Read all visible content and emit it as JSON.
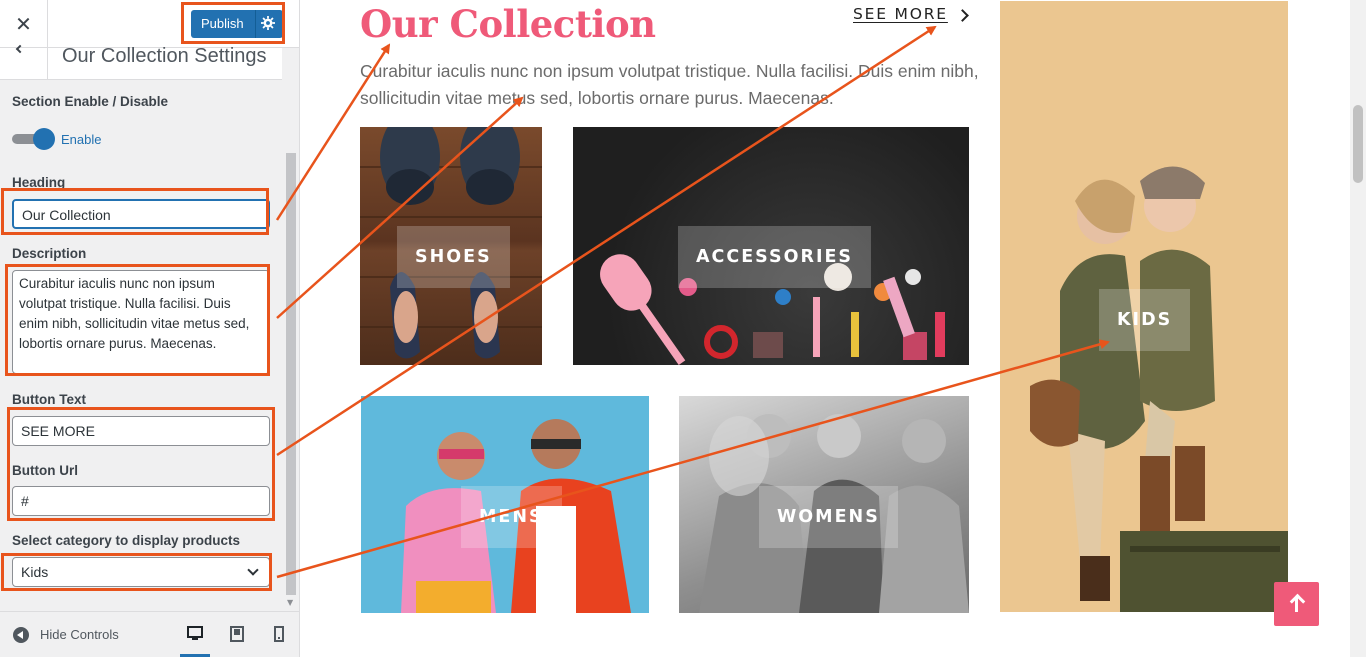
{
  "customizer": {
    "close_glyph": "✕",
    "publish_label": "Publish",
    "section_title": "Our Collection Settings",
    "enable_section_label": "Section Enable / Disable",
    "toggle_state": "on",
    "toggle_label": "Enable",
    "heading_label": "Heading",
    "heading_value": "Our Collection",
    "description_label": "Description",
    "description_value": "Curabitur iaculis nunc non ipsum volutpat tristique. Nulla facilisi. Duis enim nibh, sollicitudin vitae metus sed, lobortis ornare purus. Maecenas.",
    "button_text_label": "Button Text",
    "button_text_value": "SEE MORE",
    "button_url_label": "Button Url",
    "button_url_value": "#",
    "category_label": "Select category to display products",
    "category_value": "Kids",
    "hide_controls_label": "Hide Controls",
    "devices": [
      "desktop",
      "tablet",
      "mobile"
    ],
    "active_device": "desktop",
    "accent_color": "#2271b1"
  },
  "preview": {
    "title": "Our Collection",
    "see_more": "SEE MORE",
    "description": "Curabitur iaculis nunc non ipsum volutpat tristique. Nulla facilisi. Duis enim nibh, sollicitudin vitae metus sed, lobortis ornare purus. Maecenas.",
    "cards": {
      "shoes": "SHOES",
      "accessories": "ACCESSORIES",
      "mens": "MENS",
      "womens": "WOMENS",
      "kids": "KIDS"
    },
    "title_color": "#ef5a79",
    "scroll_top_icon": "arrow-up-icon"
  },
  "annotation_color": "#e8541c"
}
